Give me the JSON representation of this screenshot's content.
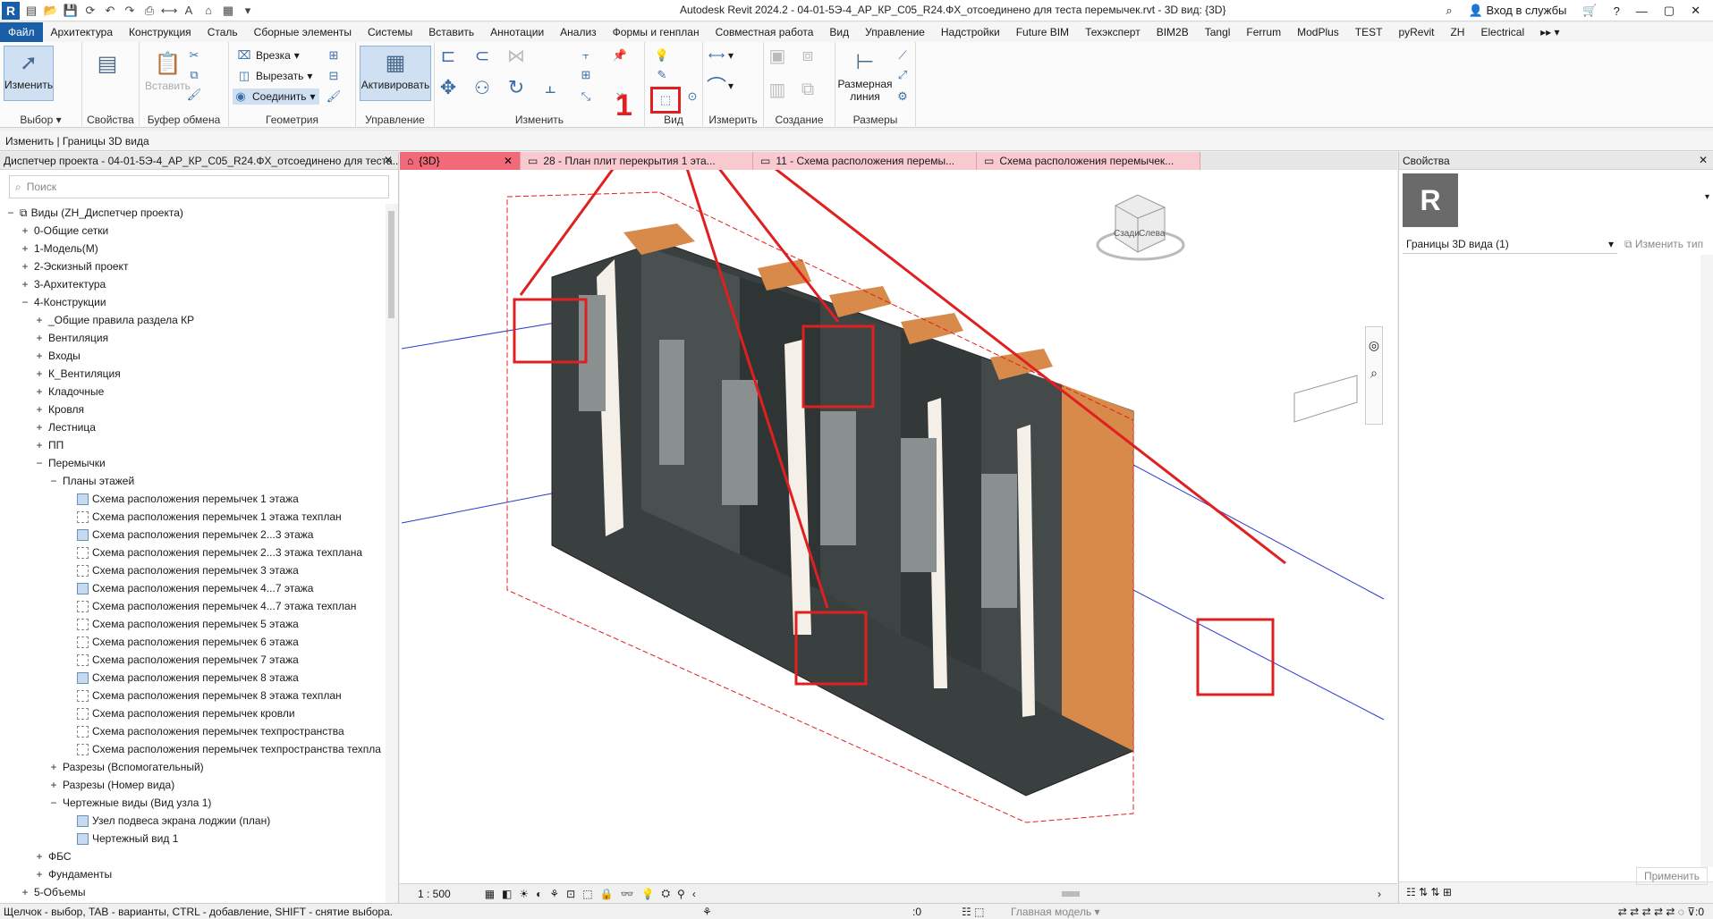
{
  "window": {
    "title": "Autodesk Revit 2024.2 - 04-01-5Э-4_АР_КР_С05_R24.ФХ_отсоединено для теста перемычек.rvt - 3D вид: {3D}",
    "sign_in": "Вход в службы"
  },
  "menu": [
    "Файл",
    "Архитектура",
    "Конструкция",
    "Сталь",
    "Сборные элементы",
    "Системы",
    "Вставить",
    "Аннотации",
    "Анализ",
    "Формы и генплан",
    "Совместная работа",
    "Вид",
    "Управление",
    "Надстройки",
    "Future BIM",
    "Техэксперт",
    "BIM2B",
    "Tangl",
    "Ferrum",
    "ModPlus",
    "TEST",
    "pyRevit",
    "ZH",
    "Electrical"
  ],
  "ribbon": {
    "modify": "Изменить",
    "select": "Выбор",
    "properties": "Свойства",
    "paste": "Вставить",
    "clipboard": "Буфер обмена",
    "cut_into": "Врезка",
    "cut": "Вырезать",
    "join": "Соединить",
    "geometry": "Геометрия",
    "activate": "Активировать",
    "control": "Управление",
    "modify_panel": "Изменить",
    "view": "Вид",
    "measure": "Измерить",
    "create": "Создание",
    "dim_line": "Размерная линия",
    "dimensions": "Размеры",
    "callout_number": "1"
  },
  "options_bar": "Изменить | Границы 3D вида",
  "project_browser": {
    "title": "Диспетчер проекта - 04-01-5Э-4_АР_КР_С05_R24.ФХ_отсоединено для теста...",
    "search_placeholder": "Поиск",
    "rows": [
      {
        "toggle": "−",
        "label": "Виды (ZH_Диспетчер проекта)",
        "level": 0,
        "icon": "views"
      },
      {
        "toggle": "+",
        "label": "0-Общие сетки",
        "level": 1
      },
      {
        "toggle": "+",
        "label": "1-Модель(М)",
        "level": 1
      },
      {
        "toggle": "+",
        "label": "2-Эскизный проект",
        "level": 1
      },
      {
        "toggle": "+",
        "label": "3-Архитектура",
        "level": 1
      },
      {
        "toggle": "−",
        "label": "4-Конструкции",
        "level": 1
      },
      {
        "toggle": "+",
        "label": "_Общие правила раздела КР",
        "level": 2
      },
      {
        "toggle": "+",
        "label": "Вентиляция",
        "level": 2
      },
      {
        "toggle": "+",
        "label": "Входы",
        "level": 2
      },
      {
        "toggle": "+",
        "label": "К_Вентиляция",
        "level": 2
      },
      {
        "toggle": "+",
        "label": "Кладочные",
        "level": 2
      },
      {
        "toggle": "+",
        "label": "Кровля",
        "level": 2
      },
      {
        "toggle": "+",
        "label": "Лестница",
        "level": 2
      },
      {
        "toggle": "+",
        "label": "ПП",
        "level": 2
      },
      {
        "toggle": "−",
        "label": "Перемычки",
        "level": 2
      },
      {
        "toggle": "−",
        "label": "Планы этажей",
        "level": 3
      },
      {
        "toggle": "",
        "label": "Схема расположения перемычек 1 этажа",
        "level": 4,
        "icon": "filled"
      },
      {
        "toggle": "",
        "label": "Схема расположения перемычек 1 этажа техплан",
        "level": 4,
        "icon": "empty"
      },
      {
        "toggle": "",
        "label": "Схема расположения перемычек 2...3 этажа",
        "level": 4,
        "icon": "filled"
      },
      {
        "toggle": "",
        "label": "Схема расположения перемычек 2...3 этажа техплана",
        "level": 4,
        "icon": "empty"
      },
      {
        "toggle": "",
        "label": "Схема расположения перемычек 3 этажа",
        "level": 4,
        "icon": "empty"
      },
      {
        "toggle": "",
        "label": "Схема расположения перемычек 4...7 этажа",
        "level": 4,
        "icon": "filled"
      },
      {
        "toggle": "",
        "label": "Схема расположения перемычек 4...7 этажа техплан",
        "level": 4,
        "icon": "empty"
      },
      {
        "toggle": "",
        "label": "Схема расположения перемычек 5 этажа",
        "level": 4,
        "icon": "empty"
      },
      {
        "toggle": "",
        "label": "Схема расположения перемычек 6 этажа",
        "level": 4,
        "icon": "empty"
      },
      {
        "toggle": "",
        "label": "Схема расположения перемычек 7 этажа",
        "level": 4,
        "icon": "empty"
      },
      {
        "toggle": "",
        "label": "Схема расположения перемычек 8 этажа",
        "level": 4,
        "icon": "filled"
      },
      {
        "toggle": "",
        "label": "Схема расположения перемычек 8 этажа техплан",
        "level": 4,
        "icon": "empty"
      },
      {
        "toggle": "",
        "label": "Схема расположения перемычек кровли",
        "level": 4,
        "icon": "empty"
      },
      {
        "toggle": "",
        "label": "Схема расположения перемычек техпространства",
        "level": 4,
        "icon": "empty"
      },
      {
        "toggle": "",
        "label": "Схема расположения перемычек техпространства техпла",
        "level": 4,
        "icon": "empty"
      },
      {
        "toggle": "+",
        "label": "Разрезы (Вспомогательный)",
        "level": 3
      },
      {
        "toggle": "+",
        "label": "Разрезы (Номер вида)",
        "level": 3
      },
      {
        "toggle": "−",
        "label": "Чертежные виды (Вид узла 1)",
        "level": 3
      },
      {
        "toggle": "",
        "label": "Узел подвеса экрана лоджии (план)",
        "level": 4,
        "icon": "filled"
      },
      {
        "toggle": "",
        "label": "Чертежный вид 1",
        "level": 4,
        "icon": "filled"
      },
      {
        "toggle": "+",
        "label": "ФБС",
        "level": 2
      },
      {
        "toggle": "+",
        "label": "Фундаменты",
        "level": 2
      },
      {
        "toggle": "+",
        "label": "5-Объемы",
        "level": 1
      }
    ]
  },
  "view_tabs": [
    {
      "label": "{3D}",
      "active": true
    },
    {
      "label": "28 - План плит перекрытия 1 эта...",
      "active": false
    },
    {
      "label": "11 - Схема расположения перемы...",
      "active": false
    },
    {
      "label": "Схема расположения перемычек...",
      "active": false
    }
  ],
  "viewcube": {
    "left": "Слева",
    "front": "Сзади"
  },
  "view_bar": {
    "scale": "1 : 500"
  },
  "properties": {
    "title": "Свойства",
    "logo": "R",
    "selection": "Границы 3D вида (1)",
    "edit_type": "Изменить тип",
    "apply": "Применить"
  },
  "status": {
    "hint": "Щелчок - выбор, TAB - варианты, CTRL - добавление, SHIFT - снятие выбора.",
    "counter": ":0",
    "model": "Главная модель"
  },
  "colors": {
    "accent": "#1a5ea8",
    "tab_active": "#f26a7a",
    "tab_inactive": "#f8c9cf",
    "annotation": "#e02020"
  }
}
